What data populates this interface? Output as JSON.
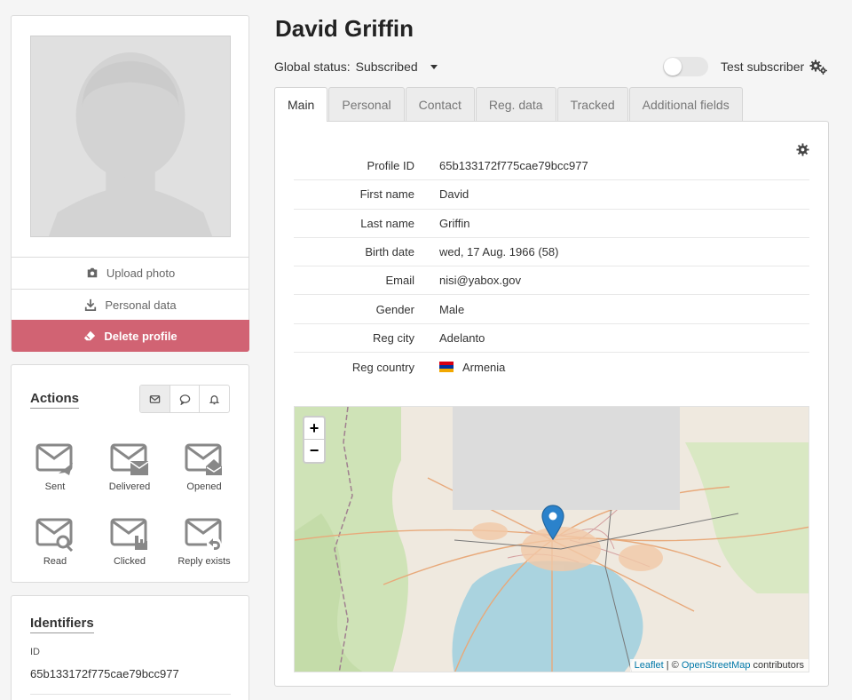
{
  "profile": {
    "upload_label": "Upload photo",
    "personal_label": "Personal data",
    "delete_label": "Delete profile"
  },
  "actions": {
    "title": "Actions",
    "items": [
      {
        "label": "Sent"
      },
      {
        "label": "Delivered"
      },
      {
        "label": "Opened"
      },
      {
        "label": "Read"
      },
      {
        "label": "Clicked"
      },
      {
        "label": "Reply exists"
      }
    ]
  },
  "identifiers": {
    "title": "Identifiers",
    "id_label": "ID",
    "id_value": "65b133172f775cae79bcc977"
  },
  "header": {
    "name": "David Griffin",
    "global_status_label": "Global status:",
    "global_status_value": "Subscribed",
    "test_subscriber_label": "Test subscriber"
  },
  "tabs": [
    {
      "label": "Main"
    },
    {
      "label": "Personal"
    },
    {
      "label": "Contact"
    },
    {
      "label": "Reg. data"
    },
    {
      "label": "Tracked"
    },
    {
      "label": "Additional fields"
    }
  ],
  "fields": [
    {
      "label": "Profile ID",
      "value": "65b133172f775cae79bcc977"
    },
    {
      "label": "First name",
      "value": "David"
    },
    {
      "label": "Last name",
      "value": "Griffin"
    },
    {
      "label": "Birth date",
      "value": "wed, 17 Aug. 1966 (58)"
    },
    {
      "label": "Email",
      "value": "nisi@yabox.gov"
    },
    {
      "label": "Gender",
      "value": "Male"
    },
    {
      "label": "Reg city",
      "value": "Adelanto"
    },
    {
      "label": "Reg country",
      "value": "Armenia"
    }
  ],
  "map": {
    "zoom_in": "+",
    "zoom_out": "−",
    "attribution_leaflet": "Leaflet",
    "attribution_sep": " | © ",
    "attribution_osm": "OpenStreetMap",
    "attribution_suffix": " contributors"
  },
  "colors": {
    "delete_bg": "#d16373",
    "marker": "#2b82cb",
    "water": "#aad3df"
  }
}
